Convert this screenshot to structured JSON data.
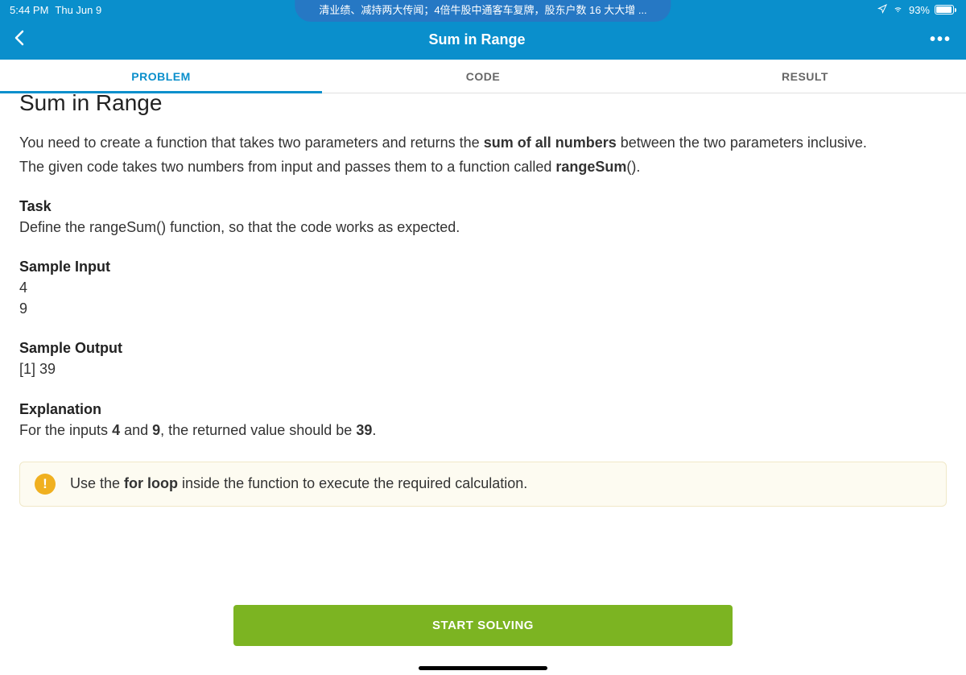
{
  "status": {
    "time": "5:44 PM",
    "date": "Thu Jun 9",
    "battery": "93%",
    "notification": "清业绩、减持两大传闻；4倍牛股中通客车复牌，股东户数 16 大大增 ..."
  },
  "nav": {
    "title": "Sum in Range"
  },
  "tabs": {
    "problem": "PROBLEM",
    "code": "CODE",
    "result": "RESULT"
  },
  "problem": {
    "title": "Sum in Range",
    "intro_pre": "You need to create a function that takes two parameters and returns the ",
    "intro_bold": "sum of all numbers",
    "intro_post": " between the two parameters inclusive.",
    "intro_line2_pre": "The given code takes two numbers from input and passes them to a function called ",
    "intro_line2_bold": "rangeSum",
    "intro_line2_post": "().",
    "task_header": "Task",
    "task_body": "Define the rangeSum() function, so that the code works as expected.",
    "sample_input_header": "Sample Input",
    "sample_input_line1": "4",
    "sample_input_line2": "9",
    "sample_output_header": "Sample Output",
    "sample_output_body": "[1] 39",
    "explanation_header": "Explanation",
    "explanation_pre": "For the inputs ",
    "explanation_b1": "4",
    "explanation_mid": " and ",
    "explanation_b2": "9",
    "explanation_mid2": ", the returned value should be ",
    "explanation_b3": "39",
    "explanation_post": ".",
    "hint_pre": "Use the ",
    "hint_bold": "for loop",
    "hint_post": " inside the function to execute the required calculation."
  },
  "cta": {
    "label": "START SOLVING"
  }
}
